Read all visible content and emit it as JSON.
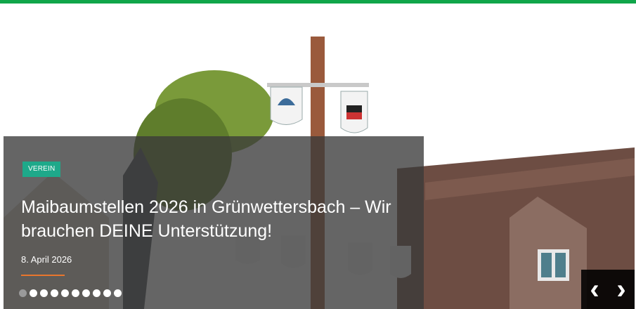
{
  "slide": {
    "category": "VEREIN",
    "title": "Maibaumstellen 2026 in Grünwettersbach – Wir brauchen DEINE Unterstützung!",
    "date": "8. April 2026",
    "dots_count": 10,
    "active_dot": 0
  },
  "nav": {
    "prev_label": "‹",
    "next_label": "›"
  },
  "colors": {
    "accent_green": "#10a64a",
    "badge_teal": "#1ea98a",
    "underline_orange": "#e8762d"
  }
}
